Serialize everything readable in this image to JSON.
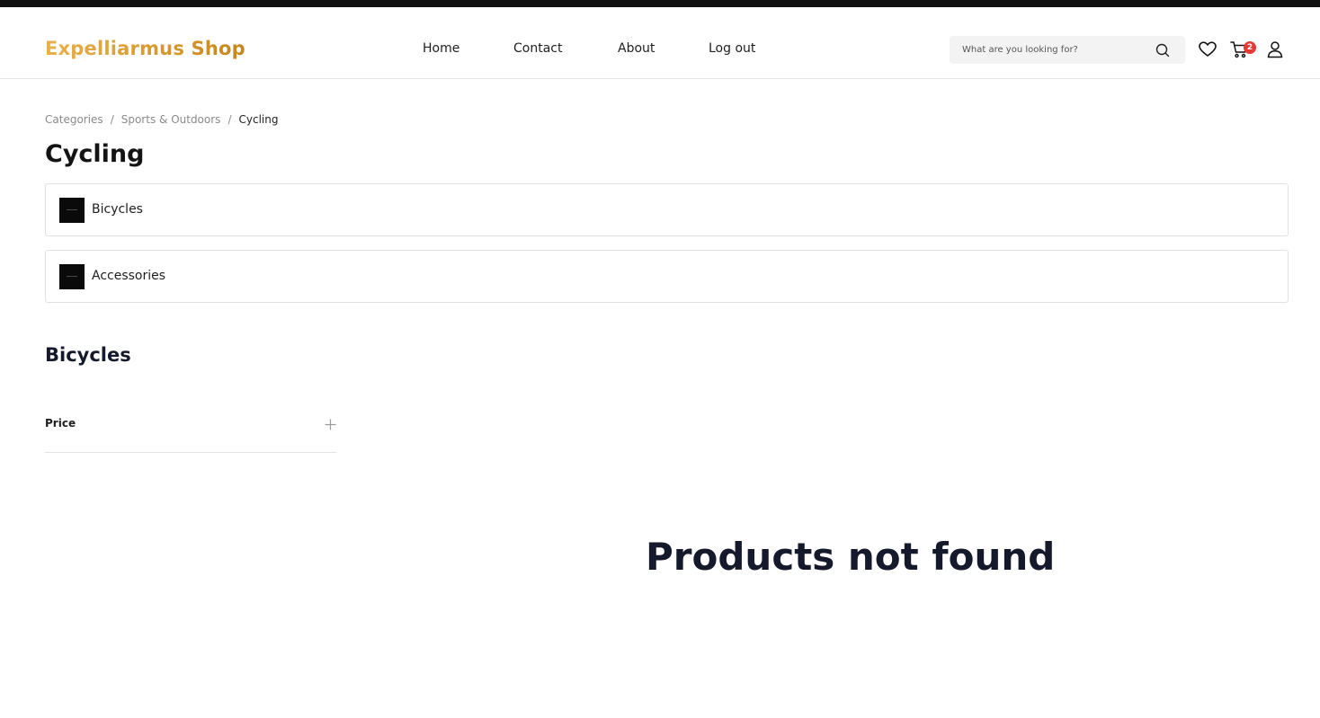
{
  "header": {
    "logo": "Expelliarmus Shop",
    "nav": [
      {
        "label": "Home"
      },
      {
        "label": "Contact"
      },
      {
        "label": "About"
      },
      {
        "label": "Log out"
      }
    ],
    "search": {
      "placeholder": "What are you looking for?",
      "value": ""
    },
    "icons": [
      "search-icon",
      "heart-icon",
      "cart-icon",
      "user-icon"
    ],
    "cart_count": "2",
    "colors": {
      "logo_gradient_start": "#e8b04b",
      "logo_gradient_end": "#c7851f",
      "badge": "#e53935"
    }
  },
  "breadcrumb": {
    "items": [
      "Categories",
      "Sports & Outdoors"
    ],
    "current": "Cycling",
    "separator": "/"
  },
  "page": {
    "title": "Cycling",
    "subcategories": [
      {
        "label": "Bicycles"
      },
      {
        "label": "Accessories"
      }
    ],
    "section_title": "Bicycles",
    "filters": [
      {
        "label": "Price",
        "expanded": false
      }
    ],
    "empty_message": "Products not found"
  }
}
